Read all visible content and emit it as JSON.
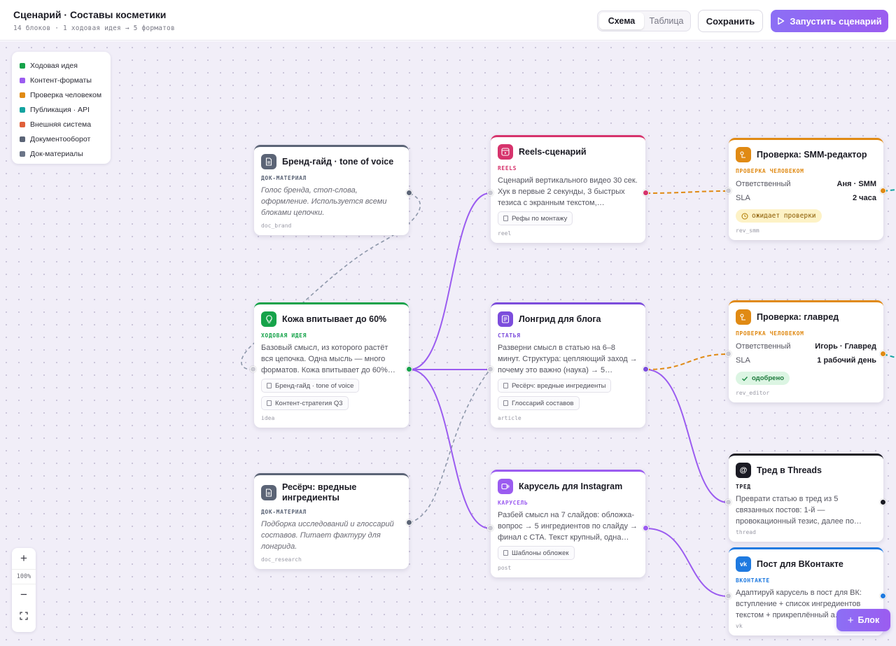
{
  "header": {
    "title": "Сценарий · Составы косметики",
    "subtitle": "14 блоков · 1 ходовая идея → 5 форматов",
    "view_tabs": [
      "Схема",
      "Таблица"
    ],
    "active_tab": "Схема",
    "save_label": "Сохранить",
    "run_label": "Запустить сценарий"
  },
  "legend": [
    {
      "label": "Ходовая идея",
      "color": "#16a34a"
    },
    {
      "label": "Контент-форматы",
      "color": "#9b5cf0"
    },
    {
      "label": "Проверка человеком",
      "color": "#e08a14"
    },
    {
      "label": "Публикация · API",
      "color": "#14a3a0"
    },
    {
      "label": "Внешняя система",
      "color": "#e0603a"
    },
    {
      "label": "Документооборот",
      "color": "#5b6476"
    },
    {
      "label": "Док-материалы",
      "color": "#6b7588"
    }
  ],
  "nodes": {
    "brand": {
      "title": "Бренд-гайд · tone of voice",
      "type": "ДОК-МАТЕРИАЛ",
      "body": "Голос бренда, стоп-слова, оформление. Используется всеми блоками цепочки.",
      "id": "doc_brand",
      "color": "#5b6476"
    },
    "idea": {
      "title": "Кожа впитывает до 60%",
      "type": "ХОДОВАЯ ИДЕЯ",
      "body": "Базовый смысл, из которого растёт вся цепочка. Одна мысль — много форматов. Кожа впитывает до 60%…",
      "tags": [
        "Бренд-гайд · tone of voice",
        "Контент-стратегия Q3"
      ],
      "id": "idea",
      "color": "#16a34a"
    },
    "research": {
      "title": "Ресёрч: вредные ингредиенты",
      "type": "ДОК-МАТЕРИАЛ",
      "body": "Подборка исследований и глоссарий составов. Питает фактуру для лонгрида.",
      "id": "doc_research",
      "color": "#5b6476"
    },
    "reels": {
      "title": "Reels-сценарий",
      "type": "REELS",
      "body": "Сценарий вертикального видео 30 сек. Хук в первые 2 секунды, 3 быстрых тезиса с экранным текстом,…",
      "tags": [
        "Рефы по монтажу"
      ],
      "id": "reel",
      "color": "#d6336c"
    },
    "longread": {
      "title": "Лонгрид для блога",
      "type": "СТАТЬЯ",
      "body": "Разверни смысл в статью на 6–8 минут. Структура: цепляющий заход → почему это важно (наука) → 5…",
      "tags": [
        "Ресёрч: вредные ингредиенты",
        "Глоссарий составов"
      ],
      "id": "article",
      "color": "#7c4ddc"
    },
    "carousel": {
      "title": "Карусель для Instagram",
      "type": "КАРУСЕЛЬ",
      "body": "Разбей смысл на 7 слайдов: обложка-вопрос → 5 ингредиентов по слайду → финал с CTA. Текст крупный, одна…",
      "tags": [
        "Шаблоны обложек"
      ],
      "id": "post",
      "color": "#9b5cf0"
    },
    "smm": {
      "title": "Проверка: SMM-редактор",
      "type": "ПРОВЕРКА ЧЕЛОВЕКОМ",
      "owner_label": "Ответственный",
      "owner": "Аня · SMM",
      "sla_label": "SLA",
      "sla": "2 часа",
      "status": "ожидает проверки",
      "id": "rev_smm",
      "color": "#e08a14"
    },
    "editor": {
      "title": "Проверка: главред",
      "type": "ПРОВЕРКА ЧЕЛОВЕКОМ",
      "owner_label": "Ответственный",
      "owner": "Игорь · Главред",
      "sla_label": "SLA",
      "sla": "1 рабочий день",
      "status": "одобрено",
      "id": "rev_editor",
      "color": "#e08a14"
    },
    "threads": {
      "title": "Тред в Threads",
      "type": "ТРЕД",
      "body": "Преврати статью в тред из 5 связанных постов: 1-й — провокационный тезис, далее по…",
      "id": "thread",
      "color": "#1b1b24"
    },
    "vk": {
      "title": "Пост для ВКонтакте",
      "type": "ВКОНТАКТЕ",
      "body": "Адаптируй карусель в пост для ВК: вступление + список ингредиентов текстом + прикреплённый а…",
      "id": "vk",
      "color": "#1f7ae0"
    }
  },
  "zoom": {
    "in": "+",
    "level": "100%",
    "out": "−",
    "fit": "⛶"
  },
  "add_block_label": "Блок"
}
